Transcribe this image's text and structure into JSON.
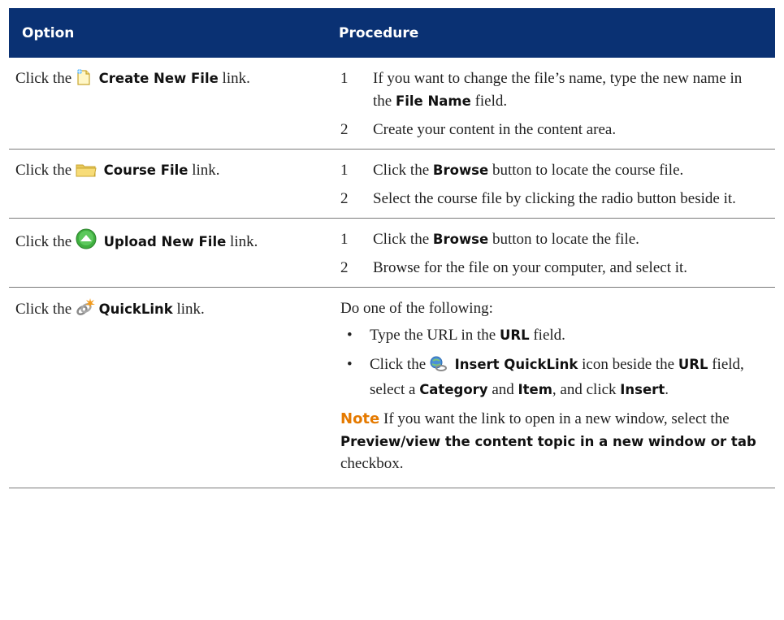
{
  "header": {
    "option": "Option",
    "procedure": "Procedure"
  },
  "common": {
    "click_the": "Click the",
    "link": "link.",
    "period": "."
  },
  "rows": [
    {
      "option_label": "Create New File",
      "icon": "new-file-icon",
      "steps": [
        {
          "n": "1",
          "pre": "If you want to change the file’s name, type the new name in the",
          "kw": "File Name",
          "post": "field."
        },
        {
          "n": "2",
          "text": "Create your content in the content area."
        }
      ]
    },
    {
      "option_label": "Course File",
      "icon": "folder-icon",
      "steps": [
        {
          "n": "1",
          "pre": "Click the",
          "kw": "Browse",
          "post": "button to locate the course file."
        },
        {
          "n": "2",
          "text": "Select the course file by clicking the radio button beside it."
        }
      ]
    },
    {
      "option_label": "Upload New File",
      "icon": "upload-icon",
      "steps": [
        {
          "n": "1",
          "pre": "Click the",
          "kw": "Browse",
          "post": "button to locate the file."
        },
        {
          "n": "2",
          "text": "Browse for the file on your computer, and select it."
        }
      ]
    },
    {
      "option_label": "QuickLink",
      "icon": "quicklink-icon",
      "intro": "Do one of the following:",
      "bullet1": {
        "pre": "Type the URL in the",
        "kw": "URL",
        "post": "field."
      },
      "bullet2": {
        "pre": "Click the",
        "kw1": "Insert QuickLink",
        "mid1": "icon beside the",
        "kw2": "URL",
        "mid2": "field, select a",
        "kw3": "Category",
        "mid3": "and",
        "kw4": "Item",
        "mid4": ", and click",
        "kw5": "Insert",
        "icon": "insert-quicklink-icon"
      },
      "note": {
        "label": "Note",
        "text": "If you want the link to open in a new window, select the",
        "kw": "Preview/view the content topic in a new window or tab",
        "post": "checkbox."
      }
    }
  ],
  "colors": {
    "header_bg": "#0a3173",
    "note": "#e57a00",
    "rule": "#7a7a7a"
  }
}
